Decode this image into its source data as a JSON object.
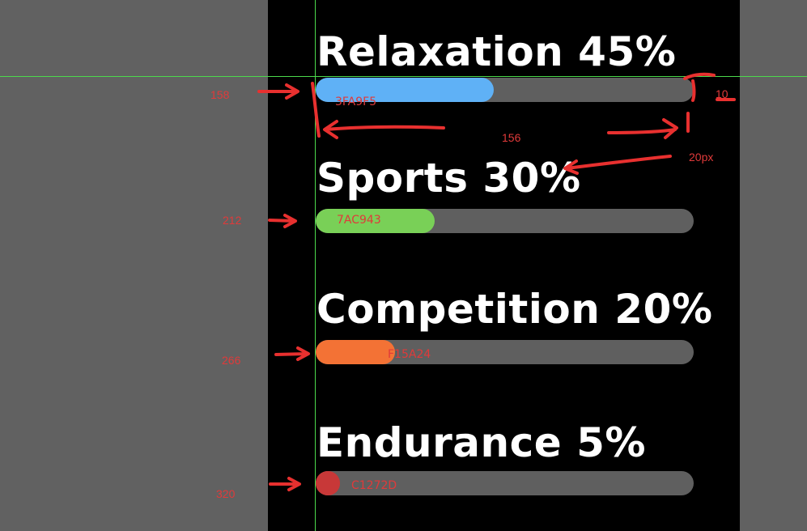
{
  "items": [
    {
      "label": "Relaxation 45%",
      "percent": 45,
      "color": "#5FB1F6",
      "hex": "3FA9F5",
      "y_note": "158"
    },
    {
      "label": "Sports 30%",
      "percent": 30,
      "color": "#79D057",
      "hex": "7AC943",
      "y_note": "212"
    },
    {
      "label": "Competition 20%",
      "percent": 20,
      "color": "#F37235",
      "hex": "F15A24",
      "y_note": "266"
    },
    {
      "label": "Endurance 5%",
      "percent": 5,
      "color": "#C83838",
      "hex": "C1272D",
      "y_note": "320"
    }
  ],
  "annotations": {
    "gap": "10",
    "width_note": "156",
    "spacing_note": "20px"
  },
  "colors": {
    "page_bg": "#616161",
    "panel_bg": "#000000",
    "track": "#5f5f5f",
    "annotation": "#e03a3a",
    "guide": "#4cd94c"
  }
}
